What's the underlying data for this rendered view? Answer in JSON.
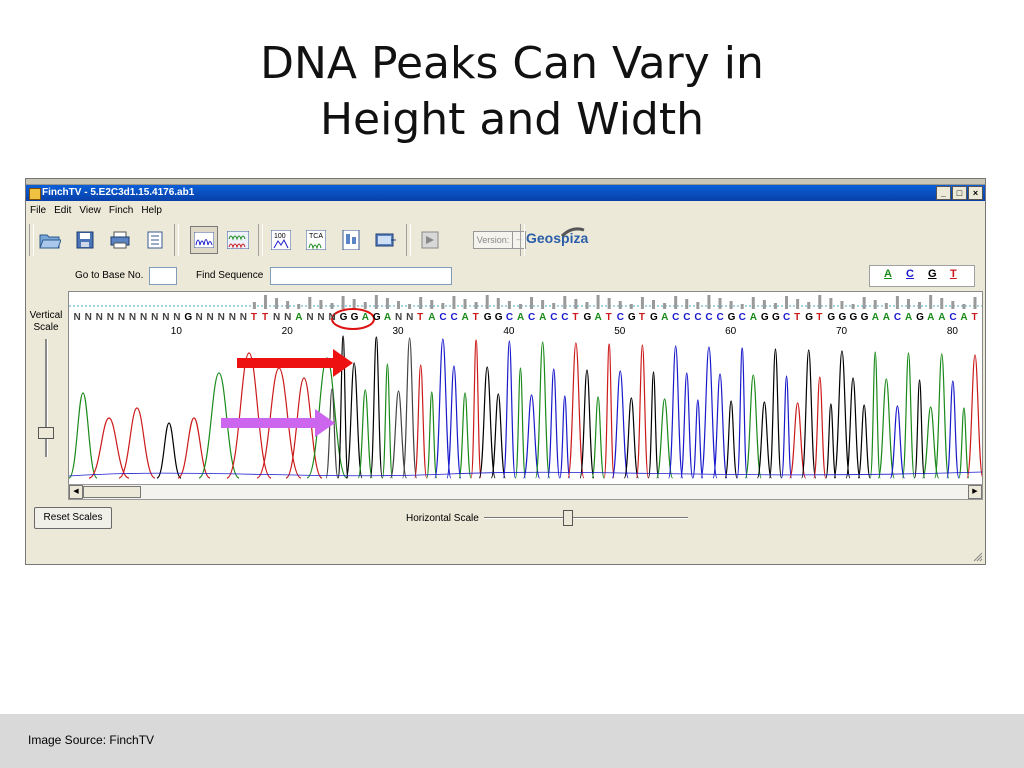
{
  "slide": {
    "title_line1": "DNA Peaks Can Vary in",
    "title_line2": "Height and Width",
    "footer": "Image Source: FinchTV"
  },
  "window": {
    "title": "FinchTV - 5.E2C3d1.15.4176.ab1",
    "min_label": "_",
    "max_label": "□",
    "close_label": "×"
  },
  "menu": [
    "File",
    "Edit",
    "View",
    "Finch",
    "Help"
  ],
  "toolbar": {
    "version_label": "Version:",
    "version_dropdown": "--",
    "brand": "Geospiza",
    "icons": [
      "open-folder-icon",
      "save-icon",
      "print-icon",
      "info-icon",
      "chromatogram-view-icon",
      "multi-view-icon",
      "quality-100-icon",
      "tca-icon",
      "sequence-icon",
      "export-icon",
      "blast-icon"
    ]
  },
  "nav": {
    "go_to_base_label": "Go to Base No.",
    "go_to_base_value": "",
    "find_sequence_label": "Find Sequence",
    "find_sequence_value": ""
  },
  "base_legend": {
    "A": {
      "label": "A",
      "color": "#1a8a1a"
    },
    "C": {
      "label": "C",
      "color": "#1a1acc"
    },
    "G": {
      "label": "G",
      "color": "#000000"
    },
    "T": {
      "label": "T",
      "color": "#cc1a1a"
    }
  },
  "vertical_scale_label": "Vertical Scale",
  "sequence": {
    "bases": [
      "N",
      "N",
      "N",
      "N",
      "N",
      "N",
      "N",
      "N",
      "N",
      "N",
      "G",
      "N",
      "N",
      "N",
      "N",
      "N",
      "T",
      "T",
      "N",
      "N",
      "A",
      "N",
      "N",
      "N",
      "G",
      "G",
      "A",
      "G",
      "A",
      "N",
      "N",
      "T",
      "A",
      "C",
      "C",
      "A",
      "T",
      "G",
      "G",
      "C",
      "A",
      "C",
      "A",
      "C",
      "C",
      "T",
      "G",
      "A",
      "T",
      "C",
      "G",
      "T",
      "G",
      "A",
      "C",
      "C",
      "C",
      "C",
      "C",
      "G",
      "C",
      "A",
      "G",
      "G",
      "C",
      "T",
      "G",
      "T",
      "G",
      "G",
      "G",
      "G",
      "A",
      "A",
      "C",
      "A",
      "G",
      "A",
      "A",
      "C",
      "A",
      "T"
    ],
    "position_labels": [
      "10",
      "20",
      "30",
      "40",
      "50",
      "60",
      "70",
      "80"
    ]
  },
  "controls": {
    "reset_scales": "Reset Scales",
    "horizontal_scale_label": "Horizontal Scale",
    "horizontal_scale_level": 0.4,
    "vertical_scale_level": 0.7
  },
  "annotations": {
    "arrow1_color": "#ee1111",
    "arrow2_color": "#cc66ee",
    "highlight_circle_color": "#dd1111"
  }
}
